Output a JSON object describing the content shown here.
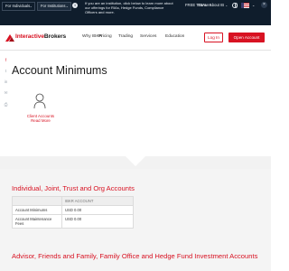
{
  "topbar": {
    "segment_individuals": "For Individuals",
    "segment_institutions": "For Institutions",
    "announcement": "If you are an institution, click below to learn more about our offerings for RIAs, Hedge Funds, Compliance Officers and more.",
    "free_trial": "FREE TRIAL",
    "careers": "Careers",
    "about_ib": "About IB",
    "close": "×",
    "chevron": "⌄"
  },
  "nav": {
    "logo_part1": "Interactive",
    "logo_part2": "Brokers",
    "items": [
      "Why IBKR",
      "Pricing",
      "Trading",
      "Services",
      "Education"
    ],
    "login": "Log In",
    "open_account": "Open Account"
  },
  "hero": {
    "title": "Account Minimums",
    "client_link": "Client Accounts Read More",
    "share_icons": [
      "facebook-icon",
      "twitter-icon",
      "linkedin-icon",
      "email-icon",
      "print-icon"
    ]
  },
  "sections": [
    {
      "title": "Individual, Joint, Trust and Org Accounts",
      "table": {
        "headers": [
          "",
          "IBKR ACCOUNT"
        ],
        "rows": [
          [
            "Account Minimums",
            "USD 0.00"
          ],
          [
            "Account Maintenance Fees",
            "USD 0.00"
          ]
        ]
      }
    },
    {
      "title": "Advisor, Friends and Family, Family Office and Hedge Fund Investment Accounts"
    }
  ],
  "colors": {
    "brand_red": "#d81222",
    "topbar_bg": "#0f1d2c"
  }
}
